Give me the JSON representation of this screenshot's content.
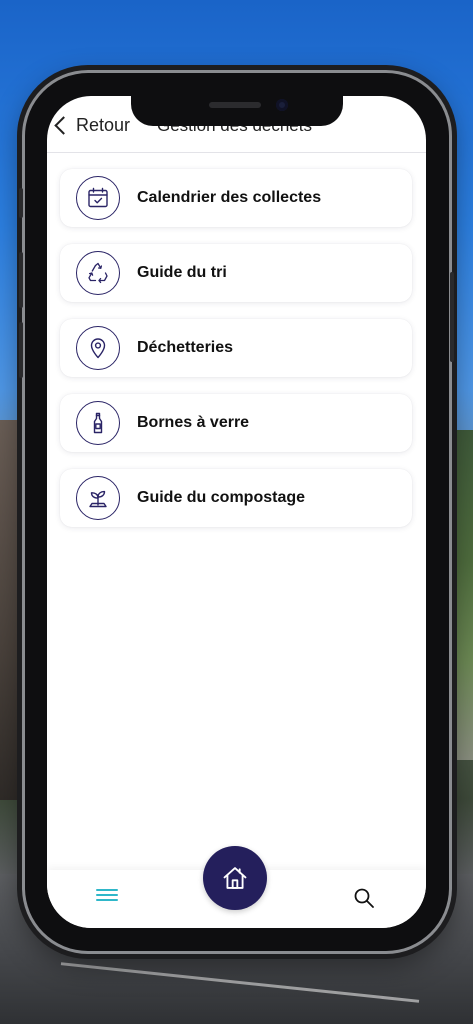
{
  "header": {
    "back_label": "Retour",
    "title": "Gestion des déchets"
  },
  "menu": {
    "items": [
      {
        "label": "Calendrier des collectes",
        "icon": "calendar-check-icon"
      },
      {
        "label": "Guide du tri",
        "icon": "recycle-icon"
      },
      {
        "label": "Déchetteries",
        "icon": "map-pin-icon"
      },
      {
        "label": "Bornes à verre",
        "icon": "bottle-icon"
      },
      {
        "label": "Guide du compostage",
        "icon": "sprout-icon"
      }
    ]
  },
  "tabbar": {
    "left_icon": "hamburger-menu-icon",
    "center_icon": "home-icon",
    "right_icon": "search-icon"
  },
  "colors": {
    "accent": "#241f5c",
    "menu_icon": "#2fb7c9",
    "icon_stroke": "#2a2466"
  }
}
